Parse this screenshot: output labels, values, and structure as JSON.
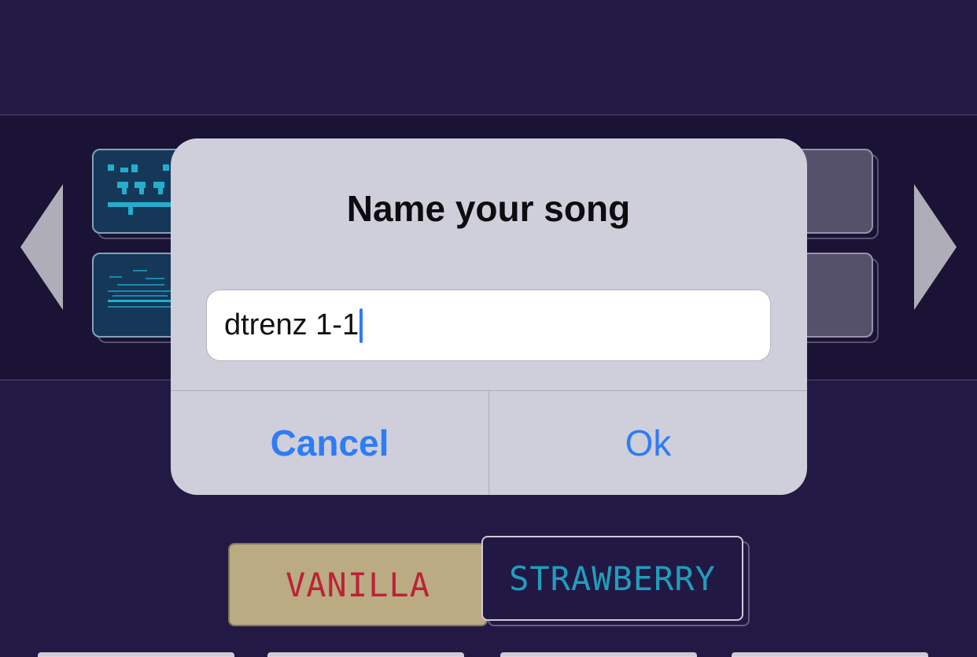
{
  "dialog": {
    "title": "Name your song",
    "input_value": "dtrenz 1-1",
    "cancel_label": "Cancel",
    "ok_label": "Ok"
  },
  "flavors": {
    "vanilla": "VANILLA",
    "strawberry": "STRAWBERRY",
    "selected": "STRAWBERRY"
  },
  "colors": {
    "background": "#221a45",
    "dialog_bg": "#cfcedb",
    "accent_blue": "#2e7cf6",
    "vanilla_bg": "#c6b58a",
    "vanilla_text": "#c8243c",
    "strawberry_text": "#21a7c7",
    "slot_pattern": "#28b7d8"
  },
  "icons": {
    "prev": "triangle-left-icon",
    "next": "triangle-right-icon"
  }
}
